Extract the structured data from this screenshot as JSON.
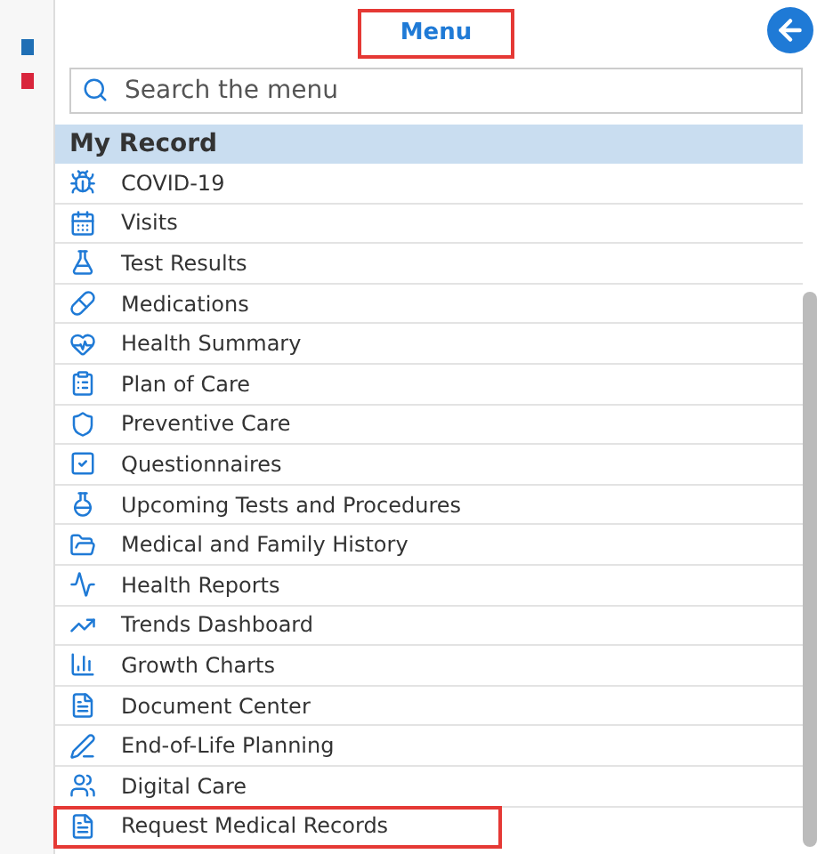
{
  "header": {
    "title": "Menu",
    "highlighted": true
  },
  "search": {
    "placeholder": "Search the menu"
  },
  "section": {
    "title": "My Record"
  },
  "items": [
    {
      "label": "COVID-19",
      "highlighted": false
    },
    {
      "label": "Visits",
      "highlighted": false
    },
    {
      "label": "Test Results",
      "highlighted": false
    },
    {
      "label": "Medications",
      "highlighted": false
    },
    {
      "label": "Health Summary",
      "highlighted": false
    },
    {
      "label": "Plan of Care",
      "highlighted": false
    },
    {
      "label": "Preventive Care",
      "highlighted": false
    },
    {
      "label": "Questionnaires",
      "highlighted": false
    },
    {
      "label": "Upcoming Tests and Procedures",
      "highlighted": false
    },
    {
      "label": "Medical and Family History",
      "highlighted": false
    },
    {
      "label": "Health Reports",
      "highlighted": false
    },
    {
      "label": "Trends Dashboard",
      "highlighted": false
    },
    {
      "label": "Growth Charts",
      "highlighted": false
    },
    {
      "label": "Document Center",
      "highlighted": false
    },
    {
      "label": "End-of-Life Planning",
      "highlighted": false
    },
    {
      "label": "Digital Care",
      "highlighted": false
    },
    {
      "label": "Request Medical Records",
      "highlighted": true
    }
  ]
}
